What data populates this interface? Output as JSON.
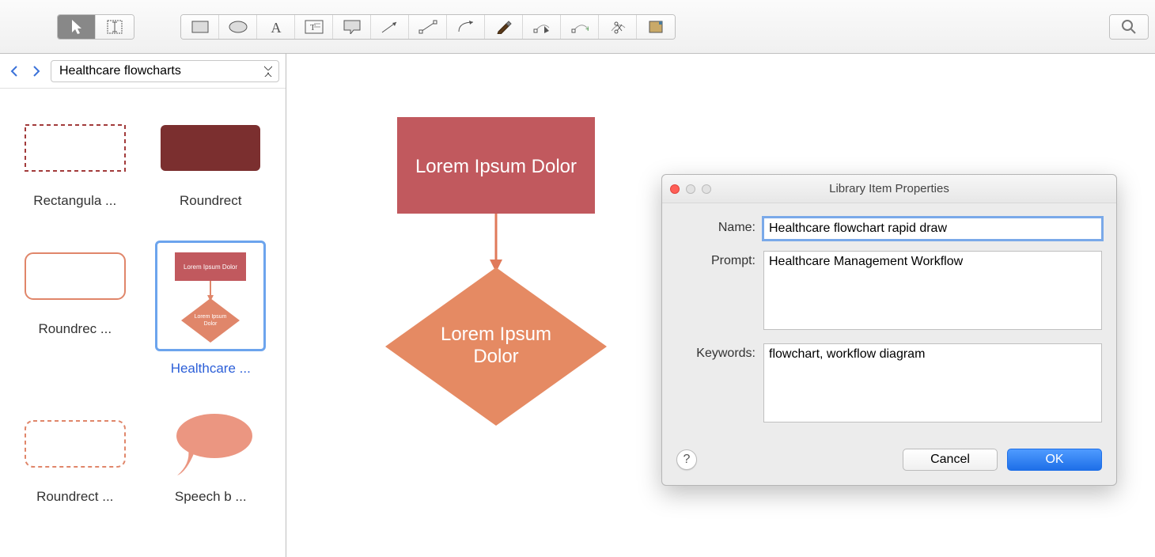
{
  "toolbar": {
    "tools": [
      {
        "name": "pointer-tool",
        "icon": "pointer"
      },
      {
        "name": "text-tool",
        "icon": "text-cursor"
      }
    ],
    "shapes": [
      {
        "name": "rectangle-shape",
        "icon": "rect"
      },
      {
        "name": "ellipse-shape",
        "icon": "ellipse"
      },
      {
        "name": "text-shape",
        "icon": "letter-a"
      },
      {
        "name": "textbox-shape",
        "icon": "textbox"
      },
      {
        "name": "callout-shape",
        "icon": "callout"
      },
      {
        "name": "arrow-tool",
        "icon": "arrow"
      },
      {
        "name": "line-tool",
        "icon": "line"
      },
      {
        "name": "curve-tool",
        "icon": "curve"
      },
      {
        "name": "pen-tool",
        "icon": "pen"
      },
      {
        "name": "edit-points-tool",
        "icon": "edit-points"
      },
      {
        "name": "add-point-tool",
        "icon": "add-point"
      },
      {
        "name": "scissors-tool",
        "icon": "scissors"
      },
      {
        "name": "swatch-tool",
        "icon": "swatch"
      }
    ],
    "search": {
      "name": "search-button"
    }
  },
  "sidebar": {
    "library_name": "Healthcare flowcharts",
    "items": [
      {
        "label": "Rectangula ...",
        "name": "shape-rectangular"
      },
      {
        "label": "Roundrect",
        "name": "shape-roundrect"
      },
      {
        "label": "Roundrec ...",
        "name": "shape-roundrec-outline"
      },
      {
        "label": "Healthcare  ...",
        "name": "shape-healthcare",
        "selected": true
      },
      {
        "label": "Roundrect ...",
        "name": "shape-roundrect-dashed"
      },
      {
        "label": "Speech b ...",
        "name": "shape-speech-bubble"
      }
    ]
  },
  "canvas": {
    "box_label": "Lorem Ipsum Dolor",
    "diamond_label_line1": "Lorem Ipsum",
    "diamond_label_line2": "Dolor"
  },
  "dialog": {
    "title": "Library Item Properties",
    "labels": {
      "name": "Name:",
      "prompt": "Prompt:",
      "keywords": "Keywords:"
    },
    "values": {
      "name": "Healthcare flowchart rapid draw",
      "prompt": "Healthcare Management Workflow",
      "keywords": "flowchart, workflow diagram"
    },
    "buttons": {
      "help": "?",
      "cancel": "Cancel",
      "ok": "OK"
    }
  },
  "preview_text": "Lorem Ipsum Dolor"
}
